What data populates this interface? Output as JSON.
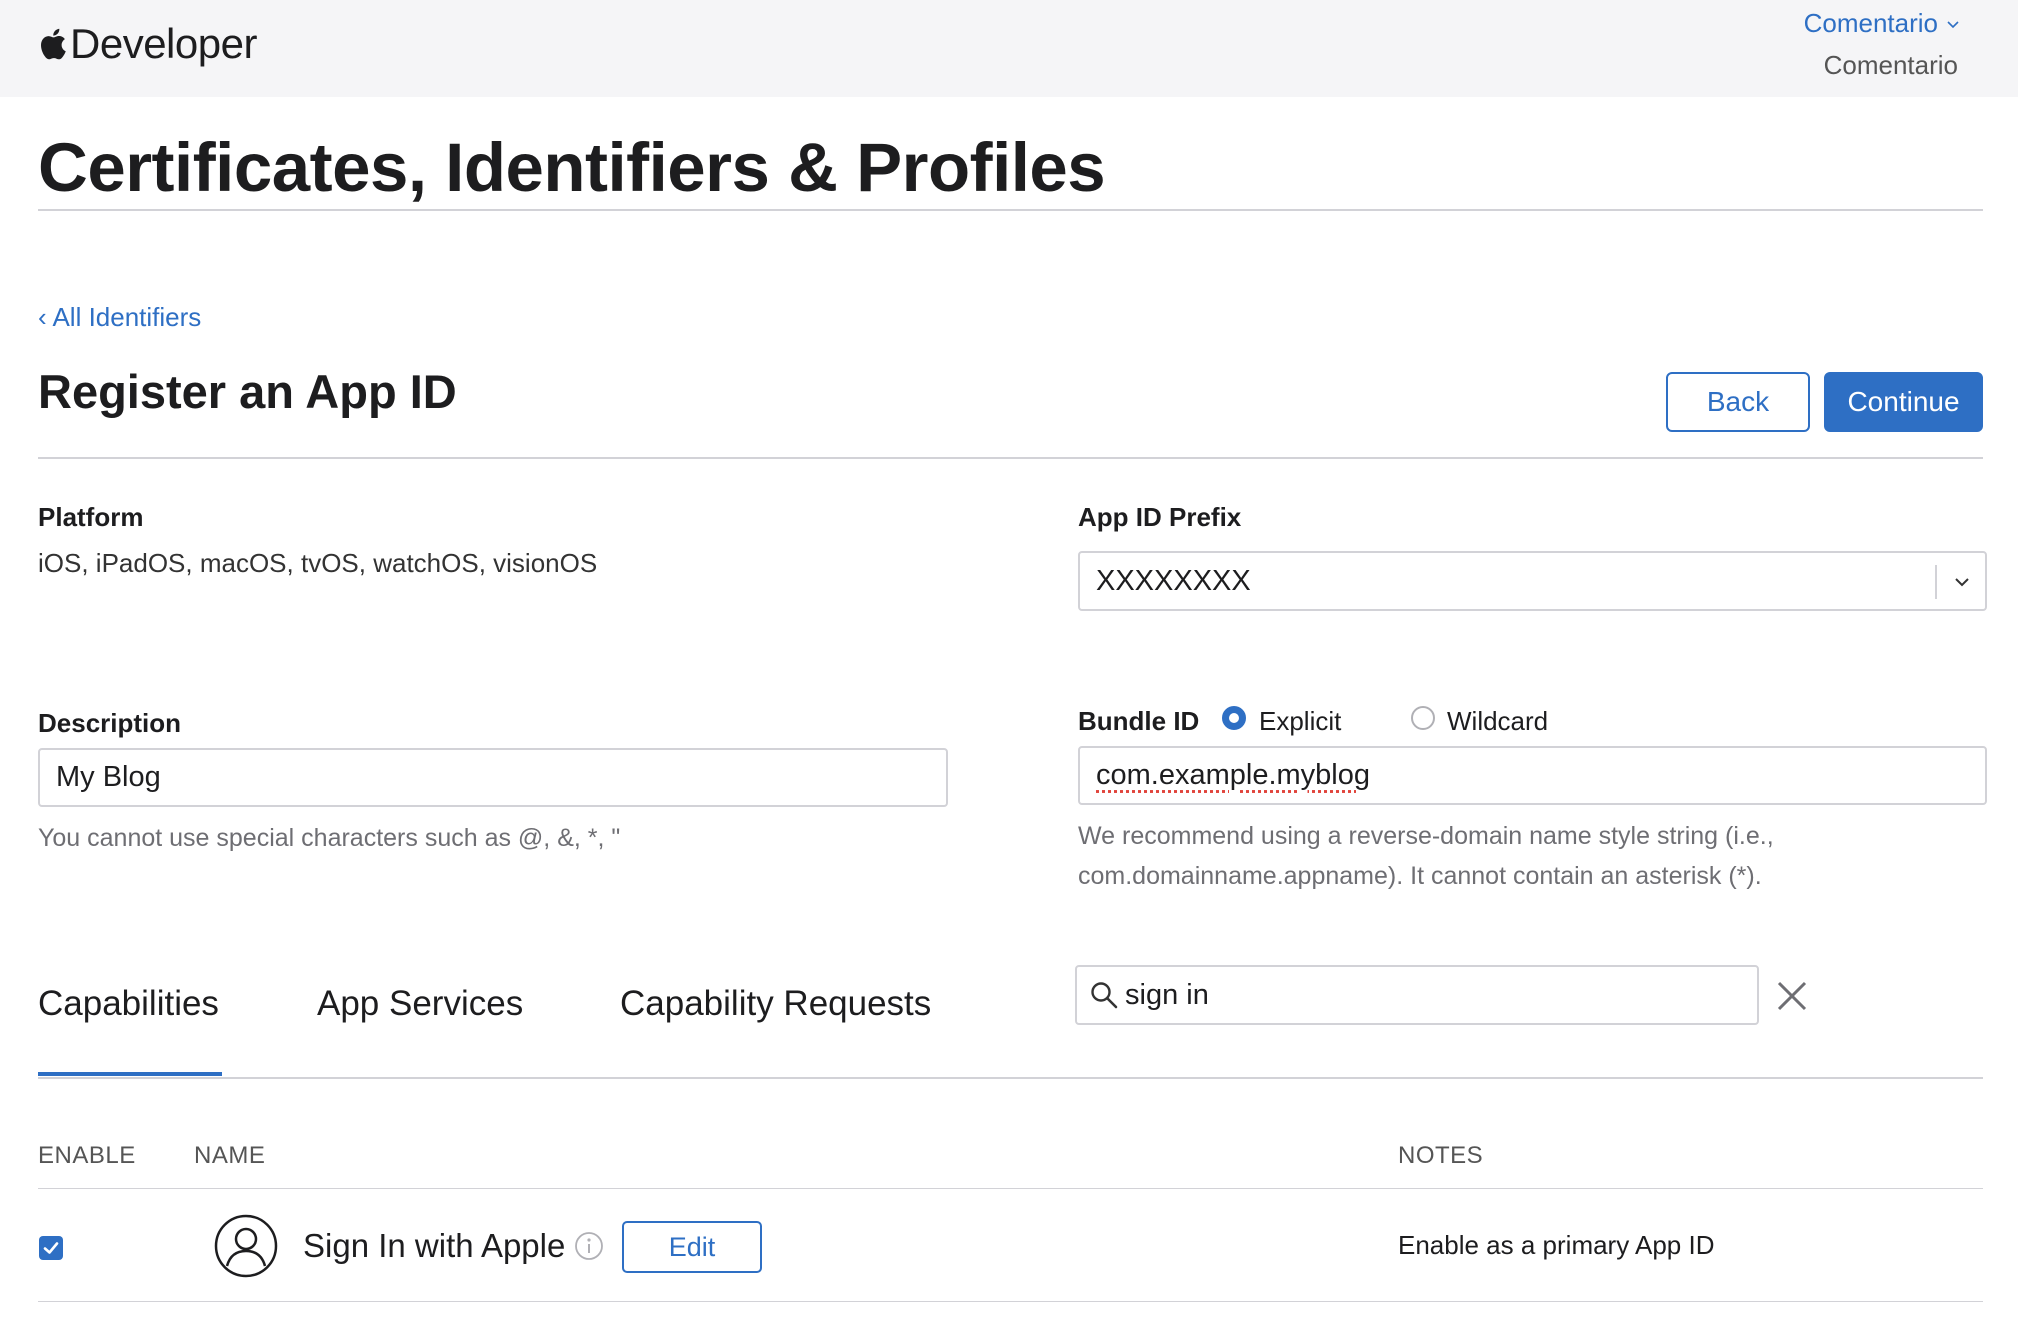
{
  "header": {
    "brand": "Developer",
    "feedback_link": "Comentario",
    "feedback_text": "Comentario"
  },
  "page": {
    "title": "Certificates, Identifiers & Profiles",
    "back_link": "All Identifiers",
    "section_title": "Register an App ID"
  },
  "actions": {
    "back": "Back",
    "continue": "Continue"
  },
  "form": {
    "platform_label": "Platform",
    "platform_value": "iOS, iPadOS, macOS, tvOS, watchOS, visionOS",
    "prefix_label": "App ID Prefix",
    "prefix_value": "XXXXXXXX",
    "description_label": "Description",
    "description_value": "My Blog",
    "description_hint": "You cannot use special characters such as @, &, *, \"",
    "bundle_label": "Bundle ID",
    "bundle_option_explicit": "Explicit",
    "bundle_option_wildcard": "Wildcard",
    "bundle_selected": "Explicit",
    "bundle_value": "com.example.myblog",
    "bundle_hint_line1": "We recommend using a reverse-domain name style string (i.e.,",
    "bundle_hint_line2": "com.domainname.appname). It cannot contain an asterisk (*)."
  },
  "tabs": {
    "items": [
      "Capabilities",
      "App Services",
      "Capability Requests"
    ],
    "active": "Capabilities"
  },
  "search": {
    "value": "sign in"
  },
  "table": {
    "headers": {
      "enable": "ENABLE",
      "name": "NAME",
      "notes": "NOTES"
    },
    "rows": [
      {
        "enabled": true,
        "name": "Sign In with Apple",
        "edit_label": "Edit",
        "notes": "Enable as a primary App ID"
      }
    ]
  },
  "colors": {
    "accent": "#2e6fc4",
    "header_bg": "#f5f5f7",
    "divider": "#d2d2d7"
  },
  "icons": [
    "apple-logo-icon",
    "chevron-down-icon",
    "search-icon",
    "close-icon",
    "person-circle-icon",
    "info-icon",
    "checkmark-icon"
  ]
}
